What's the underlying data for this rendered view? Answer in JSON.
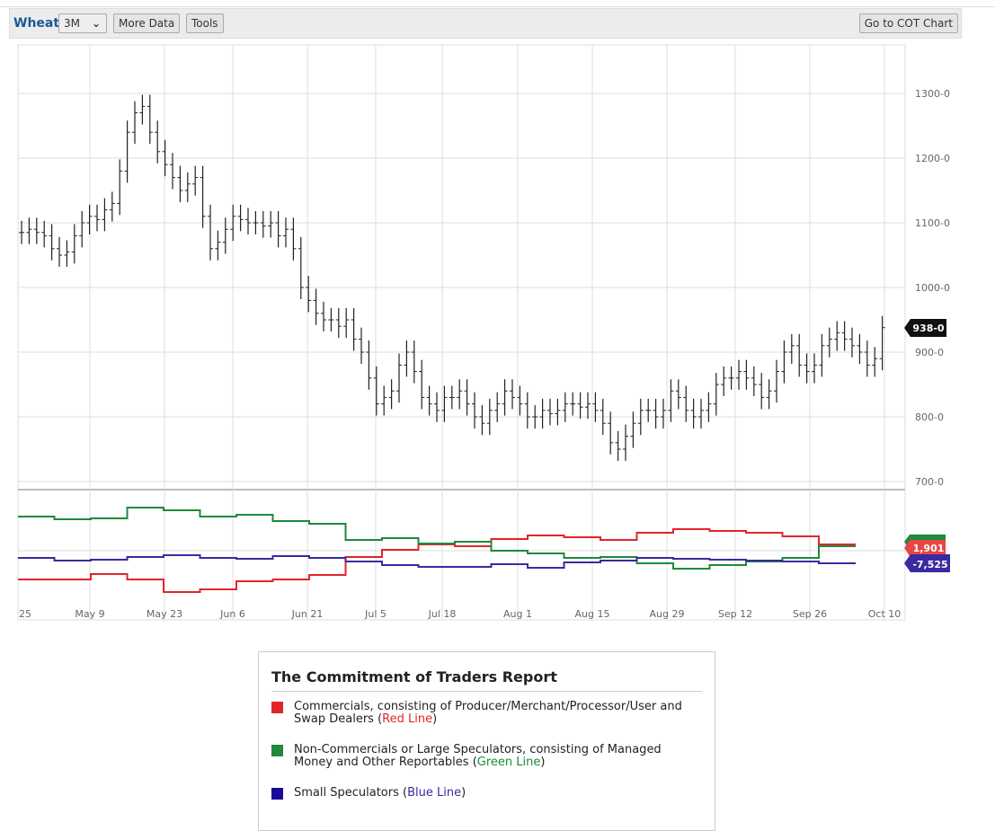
{
  "toolbar": {
    "symbol": "Wheat",
    "period": "3M",
    "more_data": "More Data",
    "tools": "Tools",
    "cot": "Go to COT Chart"
  },
  "colors": {
    "red": "#e0262b",
    "green": "#1e8a3a",
    "blue": "#3a2aa0"
  },
  "chart_data": [
    {
      "type": "ohlc",
      "title": "Wheat price",
      "ylim": [
        700,
        1300
      ],
      "y_ticks": [
        "1300-0",
        "1200-0",
        "1100-0",
        "1000-0",
        "900-0",
        "800-0",
        "700-0"
      ],
      "x_ticks": [
        "25",
        "May 9",
        "May 23",
        "Jun 6",
        "Jun 21",
        "Jul 5",
        "Jul 18",
        "Aug 1",
        "Aug 15",
        "Aug 29",
        "Sep 12",
        "Sep 26",
        "Oct 10"
      ],
      "last_label": "938-0",
      "closes": [
        1085,
        1090,
        1085,
        1080,
        1060,
        1050,
        1055,
        1080,
        1100,
        1110,
        1105,
        1120,
        1130,
        1180,
        1240,
        1270,
        1280,
        1240,
        1210,
        1190,
        1170,
        1150,
        1160,
        1170,
        1110,
        1060,
        1070,
        1090,
        1110,
        1105,
        1100,
        1100,
        1095,
        1100,
        1080,
        1090,
        1060,
        1000,
        980,
        960,
        950,
        950,
        940,
        950,
        920,
        900,
        860,
        820,
        830,
        840,
        880,
        900,
        870,
        830,
        820,
        810,
        830,
        830,
        840,
        820,
        800,
        790,
        810,
        820,
        840,
        830,
        820,
        800,
        800,
        810,
        805,
        810,
        820,
        820,
        815,
        820,
        810,
        790,
        760,
        750,
        770,
        790,
        810,
        810,
        800,
        810,
        840,
        830,
        810,
        800,
        810,
        820,
        850,
        860,
        860,
        870,
        860,
        850,
        830,
        840,
        870,
        900,
        910,
        880,
        870,
        880,
        910,
        920,
        930,
        920,
        910,
        900,
        880,
        890,
        938
      ]
    },
    {
      "type": "line",
      "title": "Commitment of Traders",
      "series": [
        {
          "name": "Commercials",
          "color": "#e0262b",
          "values": [
            -8000,
            -8000,
            -6500,
            -8000,
            -11500,
            -10750,
            -8500,
            -8000,
            -6750,
            -1750,
            250,
            1750,
            1250,
            3250,
            4250,
            3750,
            3000,
            5000,
            6000,
            5500,
            5000,
            4000,
            1750
          ],
          "last_label": "1,901"
        },
        {
          "name": "Non-Commercials",
          "color": "#1e8a3a",
          "values": [
            9500,
            8750,
            9000,
            12000,
            11250,
            9500,
            10000,
            8250,
            7500,
            3000,
            3500,
            2000,
            2500,
            0,
            -750,
            -2000,
            -1750,
            -3500,
            -5000,
            -4000,
            -3000,
            -2000,
            1250
          ],
          "last_label": ""
        },
        {
          "name": "Small Speculators",
          "color": "#3a2aa0",
          "values": [
            -2000,
            -2750,
            -2500,
            -1750,
            -1250,
            -2000,
            -2250,
            -1500,
            -2000,
            -3000,
            -4000,
            -4500,
            -4500,
            -3750,
            -4750,
            -3250,
            -2750,
            -2000,
            -2250,
            -2500,
            -2750,
            -3000,
            -3500
          ],
          "last_label": "-7,525"
        }
      ]
    }
  ],
  "legend": {
    "title": "The Commitment of Traders Report",
    "items": [
      {
        "text": "Commercials, consisting of Producer/Merchant/Processor/User and Swap Dealers (",
        "tag": "Red Line",
        "end": ")"
      },
      {
        "text": "Non-Commercials or Large Speculators, consisting of Managed Money and Other Reportables (",
        "tag": "Green Line",
        "end": ")"
      },
      {
        "text": "Small Speculators (",
        "tag": "Blue Line",
        "end": ")"
      }
    ]
  }
}
